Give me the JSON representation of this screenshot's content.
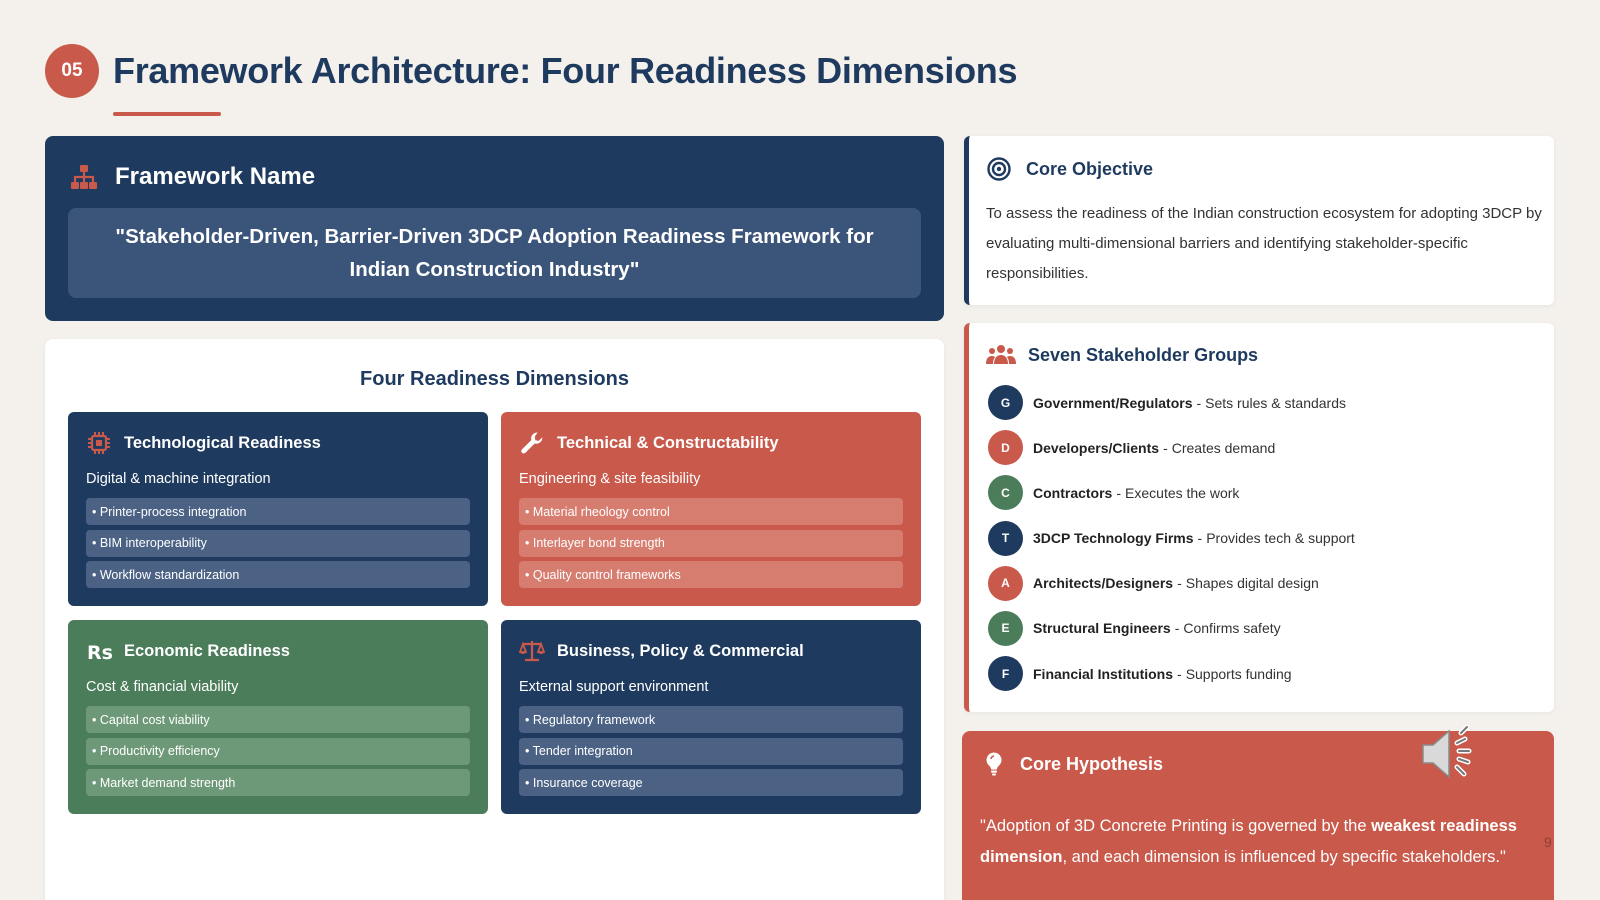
{
  "header": {
    "number": "05",
    "title": "Framework Architecture: Four Readiness Dimensions"
  },
  "framework": {
    "label": "Framework Name",
    "icon": "hierarchy-icon",
    "quote": "\"Stakeholder-Driven, Barrier-Driven 3DCP Adoption Readiness Framework for Indian Construction Industry\""
  },
  "dimensions": {
    "title": "Four Readiness Dimensions",
    "items": [
      {
        "title": "Technological Readiness",
        "subtitle": "Digital & machine integration",
        "icon": "chip-icon",
        "bullets": [
          "• Printer-process integration",
          "• BIM interoperability",
          "• Workflow standardization"
        ]
      },
      {
        "title": "Technical & Constructability",
        "subtitle": "Engineering & site feasibility",
        "icon": "wrench-icon",
        "bullets": [
          "• Material rheology control",
          "• Interlayer bond strength",
          "• Quality control frameworks"
        ]
      },
      {
        "title": "Economic Readiness",
        "subtitle": "Cost & financial viability",
        "icon": "rupee-icon",
        "bullets": [
          "• Capital cost viability",
          "• Productivity efficiency",
          "• Market demand strength"
        ]
      },
      {
        "title": "Business, Policy & Commercial",
        "subtitle": "External support environment",
        "icon": "scale-icon",
        "bullets": [
          "• Regulatory framework",
          "• Tender integration",
          "• Insurance coverage"
        ]
      }
    ]
  },
  "objective": {
    "label": "Core Objective",
    "icon": "target-icon",
    "text": "To assess the readiness of the Indian construction ecosystem for adopting 3DCP by evaluating multi-dimensional barriers and identifying stakeholder-specific responsibilities."
  },
  "stakeholders": {
    "label": "Seven Stakeholder Groups",
    "icon": "users-icon",
    "items": [
      {
        "initial": "G",
        "name": "Government/Regulators",
        "sep": "-",
        "role": "Sets rules & standards",
        "color": "#1f3a5f"
      },
      {
        "initial": "D",
        "name": "Developers/Clients",
        "sep": "-",
        "role": "Creates demand",
        "color": "#c9594a"
      },
      {
        "initial": "C",
        "name": "Contractors",
        "sep": "-",
        "role": "Executes the work",
        "color": "#4b7d5a"
      },
      {
        "initial": "T",
        "name": "3DCP Technology Firms",
        "sep": "-",
        "role": "Provides tech & support",
        "color": "#1f3a5f"
      },
      {
        "initial": "A",
        "name": "Architects/Designers",
        "sep": "-",
        "role": "Shapes digital design",
        "color": "#c9594a"
      },
      {
        "initial": "E",
        "name": "Structural Engineers",
        "sep": "-",
        "role": "Confirms safety",
        "color": "#4b7d5a"
      },
      {
        "initial": "F",
        "name": "Financial Institutions",
        "sep": "-",
        "role": "Supports funding",
        "color": "#1f3a5f"
      }
    ]
  },
  "hypothesis": {
    "label": "Core Hypothesis",
    "icon": "lightbulb-icon",
    "text_before": "\"Adoption of 3D Concrete Printing is governed by the ",
    "text_bold": "weakest readiness dimension",
    "text_after": ", and each dimension is influenced by specific stakeholders.\""
  },
  "audio_icon": "speaker-icon",
  "page_number": "9",
  "colors": {
    "navy": "#1f3a5f",
    "red": "#c9594a",
    "green": "#4b7d5a",
    "background": "#f4f1ec"
  }
}
